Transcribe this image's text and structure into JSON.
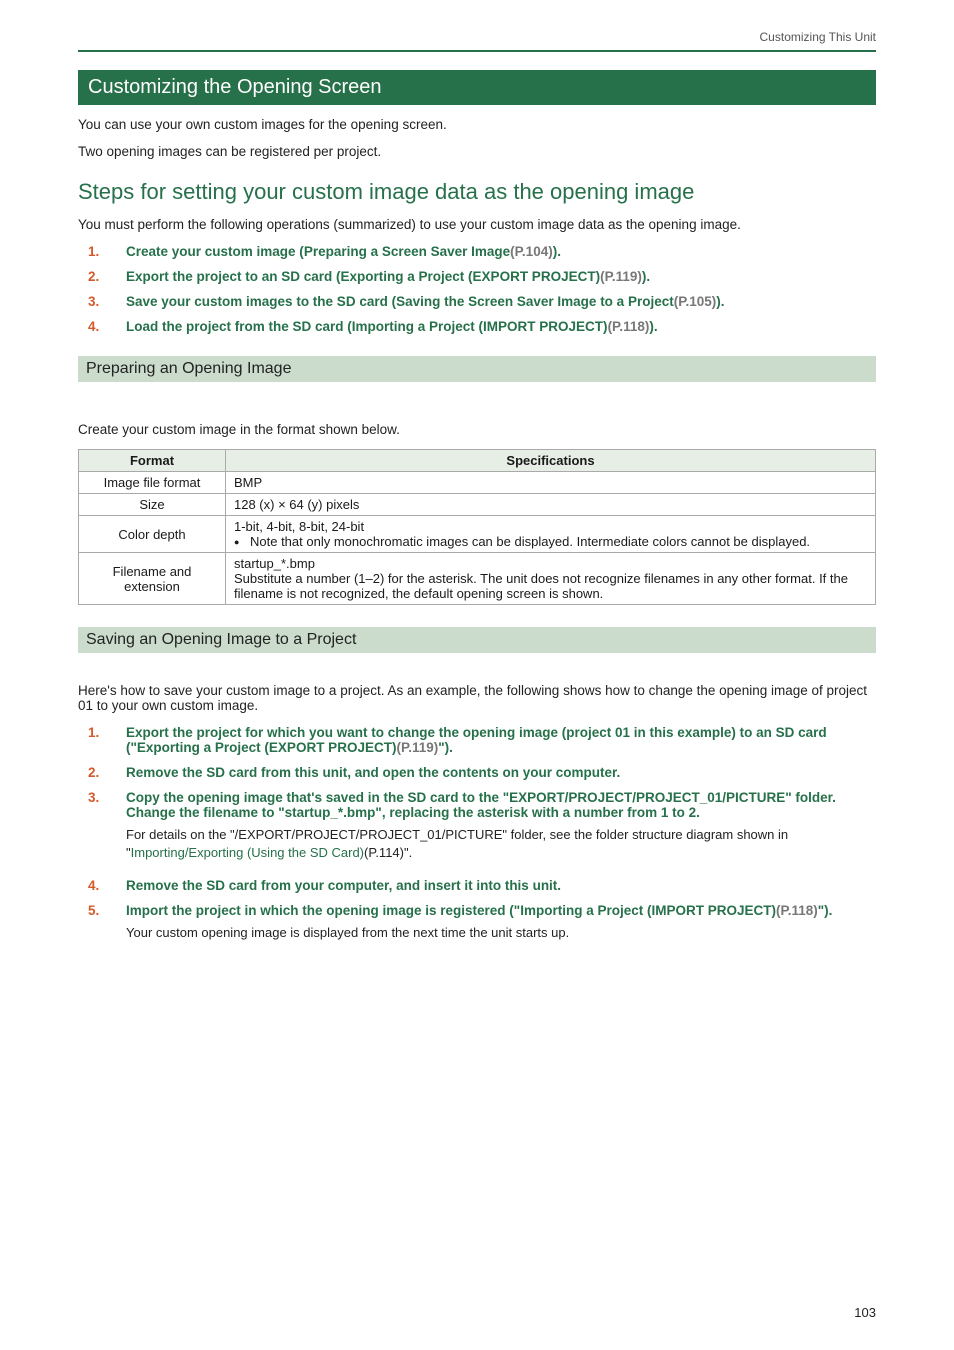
{
  "header": {
    "section": "Customizing This Unit"
  },
  "h1": "Customizing the Opening Screen",
  "intro1": "You can use your own custom images for the opening screen.",
  "intro2": "Two opening images can be registered per project.",
  "h2": "Steps for setting your custom image data as the opening image",
  "h2_intro": "You must perform the following operations (summarized) to use your custom image data as the opening image.",
  "steps_a": [
    {
      "n": "1.",
      "pre": "Create your custom image (",
      "link": "Preparing a Screen Saver Image",
      "pref": "(P.104)",
      "post": ")."
    },
    {
      "n": "2.",
      "pre": "Export the project to an SD card (",
      "link": "Exporting a Project (EXPORT PROJECT)",
      "pref": "(P.119)",
      "post": ")."
    },
    {
      "n": "3.",
      "pre": "Save your custom images to the SD card (",
      "link": "Saving the Screen Saver Image to a Project",
      "pref": "(P.105)",
      "post": ")."
    },
    {
      "n": "4.",
      "pre": "Load the project from the SD card (",
      "link": "Importing a Project (IMPORT PROJECT)",
      "pref": "(P.118)",
      "post": ")."
    }
  ],
  "h3a": "Preparing an Opening Image",
  "h3a_intro": "Create your custom image in the format shown below.",
  "table": {
    "headers": [
      "Format",
      "Specifications"
    ],
    "rows": [
      {
        "label": "Image file format",
        "spec_lines": [
          "BMP"
        ]
      },
      {
        "label": "Size",
        "spec_lines": [
          "128 (x) × 64 (y) pixels"
        ]
      },
      {
        "label": "Color depth",
        "spec_lines": [
          "1-bit, 4-bit, 8-bit, 24-bit"
        ],
        "bullet": "Note that only monochromatic images can be displayed. Intermediate colors cannot be displayed."
      },
      {
        "label": "Filename and extension",
        "spec_lines": [
          "startup_*.bmp",
          "Substitute a number (1–2) for the asterisk. The unit does not recognize filenames in any other format. If the filename is not recognized, the default opening screen is shown."
        ]
      }
    ]
  },
  "h3b": "Saving an Opening Image to a Project",
  "h3b_intro": "Here's how to save your custom image to a project. As an example, the following shows how to change the opening image of project 01 to your own custom image.",
  "steps_b": [
    {
      "n": "1.",
      "body_pre": "Export the project for which you want to change the opening image (project 01 in this example) to an SD card (\"",
      "link": "Exporting a Project (EXPORT PROJECT)",
      "pref": "(P.119)",
      "body_post": "\")."
    },
    {
      "n": "2.",
      "body_plain": "Remove the SD card from this unit, and open the contents on your computer."
    },
    {
      "n": "3.",
      "body_plain": "Copy the opening image that's saved in the SD card to the \"EXPORT/PROJECT/PROJECT_01/PICTURE\" folder. Change the filename to \"startup_*.bmp\", replacing the asterisk with a number from 1 to 2.",
      "sub_pre": "For details on the \"/EXPORT/PROJECT/PROJECT_01/PICTURE\" folder, see the folder structure diagram shown in \"",
      "sub_link": "Importing/Exporting (Using the SD Card)",
      "sub_pref": "(P.114)",
      "sub_post": "\"."
    },
    {
      "n": "4.",
      "body_plain": "Remove the SD card from your computer, and insert it into this unit."
    },
    {
      "n": "5.",
      "body_pre": "Import the project in which the opening image is registered (\"",
      "link": "Importing a Project (IMPORT PROJECT)",
      "pref": "(P.118)",
      "body_post": "\").",
      "sub_plain": "Your custom opening image is displayed from the next time the unit starts up."
    }
  ],
  "page_number": "103"
}
